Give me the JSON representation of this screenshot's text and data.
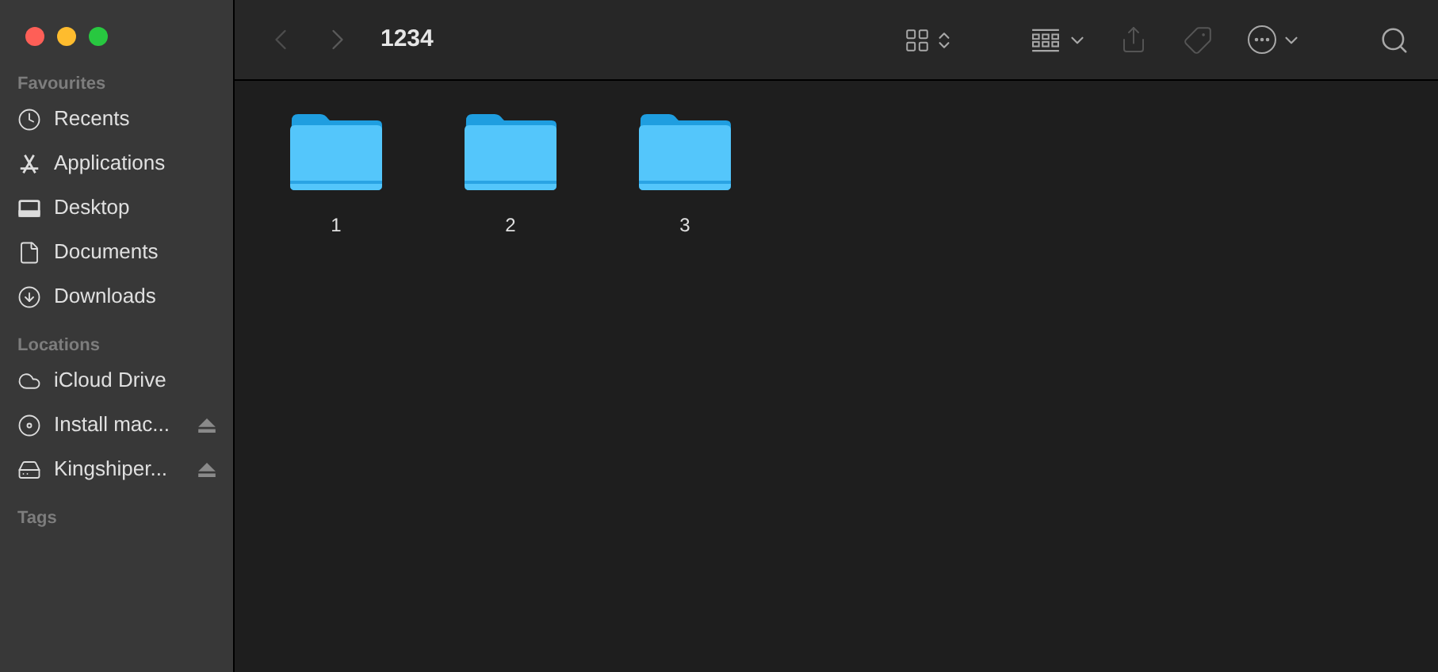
{
  "sidebar": {
    "sections": [
      {
        "title": "Favourites",
        "items": [
          {
            "label": "Recents",
            "ejectable": false
          },
          {
            "label": "Applications",
            "ejectable": false
          },
          {
            "label": "Desktop",
            "ejectable": false
          },
          {
            "label": "Documents",
            "ejectable": false
          },
          {
            "label": "Downloads",
            "ejectable": false
          }
        ]
      },
      {
        "title": "Locations",
        "items": [
          {
            "label": "iCloud Drive",
            "ejectable": false
          },
          {
            "label": "Install mac...",
            "ejectable": true
          },
          {
            "label": "Kingshiper...",
            "ejectable": true
          }
        ]
      },
      {
        "title": "Tags"
      }
    ]
  },
  "toolbar": {
    "title": "1234"
  },
  "files": [
    {
      "name": "1"
    },
    {
      "name": "2"
    },
    {
      "name": "3"
    }
  ]
}
